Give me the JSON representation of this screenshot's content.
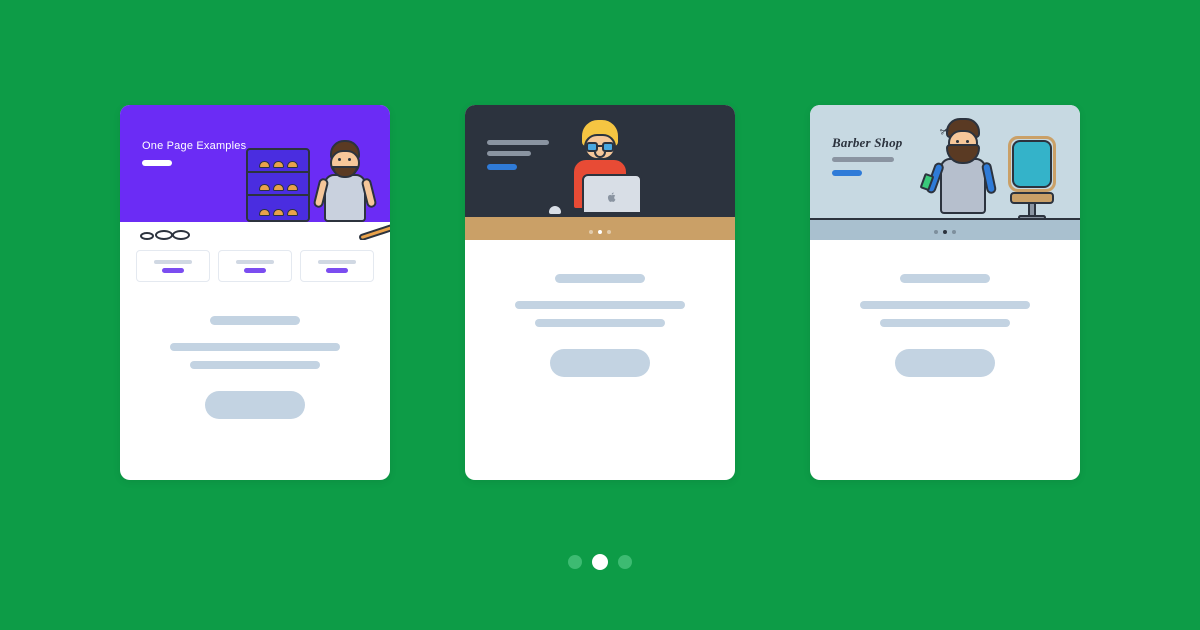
{
  "carousel": {
    "active_index": 1,
    "dot_count": 3
  },
  "cards": [
    {
      "hero_title": "One Page Examples",
      "illustration": "baker",
      "inner_dot_count": 0
    },
    {
      "hero_title": "",
      "illustration": "developer",
      "inner_dot_count": 3,
      "inner_active": 1
    },
    {
      "hero_title": "Barber Shop",
      "illustration": "barber",
      "inner_dot_count": 3,
      "inner_active": 1
    }
  ],
  "colors": {
    "background": "#0d9c47",
    "card1_hero": "#6b2cf5",
    "card2_hero": "#2c333e",
    "card3_hero": "#c7d9e2",
    "accent_blue": "#2f7bd8",
    "placeholder": "#c3d3e2"
  },
  "icons": {
    "scissors": "scissors-icon",
    "apple": "apple-logo-icon"
  }
}
